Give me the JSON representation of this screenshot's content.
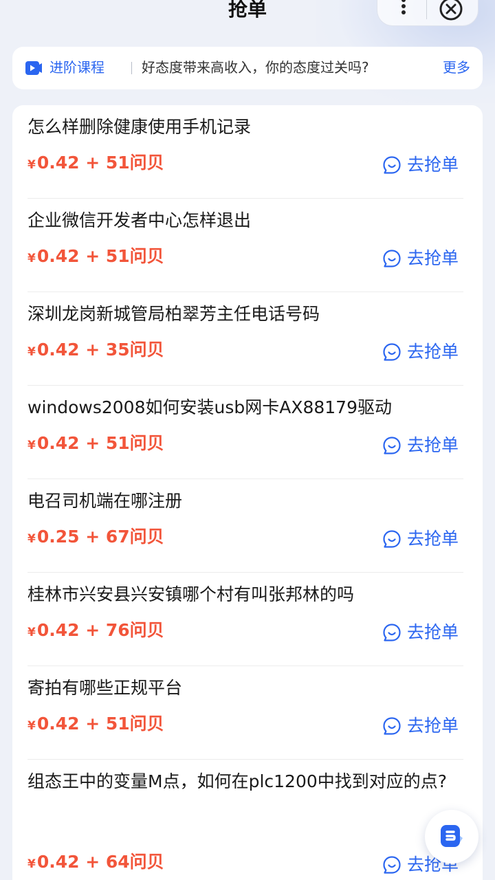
{
  "header": {
    "title": "抢单"
  },
  "banner": {
    "label": "进阶课程",
    "text": "好态度带来高收入，你的态度过关吗?",
    "more": "更多"
  },
  "grab_label": "去抢单",
  "items": [
    {
      "title": "怎么样删除健康使用手机记录",
      "yen": "¥",
      "reward": "0.42 + 51问贝"
    },
    {
      "title": "企业微信开发者中心怎样退出",
      "yen": "¥",
      "reward": "0.42 + 51问贝"
    },
    {
      "title": "深圳龙岗新城管局柏翠芳主任电话号码",
      "yen": "¥",
      "reward": "0.42 + 35问贝"
    },
    {
      "title": "windows2008如何安装usb网卡AX88179驱动",
      "yen": "¥",
      "reward": "0.42 + 51问贝"
    },
    {
      "title": "电召司机端在哪注册",
      "yen": "¥",
      "reward": "0.25 + 67问贝"
    },
    {
      "title": "桂林市兴安县兴安镇哪个村有叫张邦林的吗",
      "yen": "¥",
      "reward": "0.42 + 76问贝"
    },
    {
      "title": "寄拍有哪些正规平台",
      "yen": "¥",
      "reward": "0.42 + 51问贝"
    },
    {
      "title": "组态王中的变量M点，如何在plc1200中找到对应的点?",
      "yen": "¥",
      "reward": "0.42 + 64问贝"
    }
  ],
  "colors": {
    "accent": "#2b66f0",
    "reward": "#f2553a",
    "background": "#eef1f8"
  },
  "icons": {
    "more": "more-vertical-icon",
    "close": "close-circle-icon",
    "banner": "course-play-icon",
    "grab": "smile-bubble-icon",
    "float": "assistant-icon"
  }
}
